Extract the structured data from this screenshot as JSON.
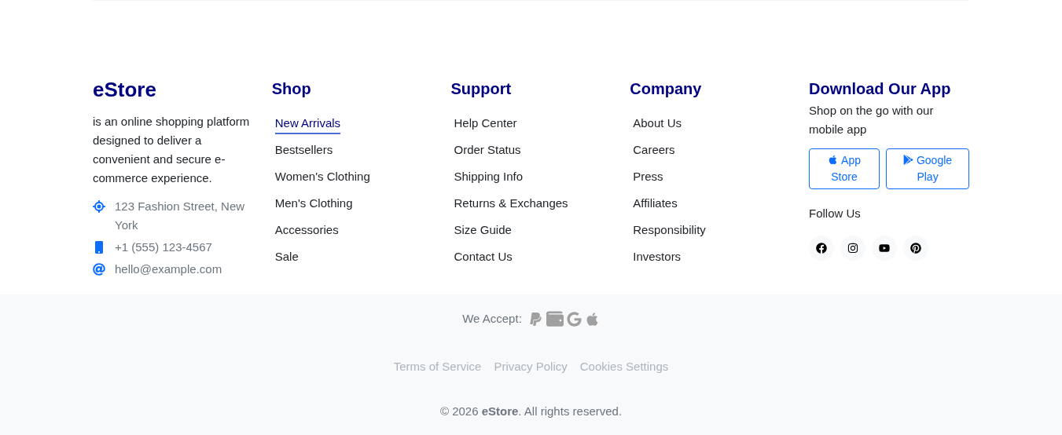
{
  "brand": {
    "name": "eStore",
    "description": "is an online shopping platform designed to deliver a convenient and secure e-commerce experience.",
    "contacts": [
      {
        "kind": "location",
        "text": "123 Fashion Street, New York"
      },
      {
        "kind": "phone",
        "text": "+1 (555) 123-4567"
      },
      {
        "kind": "email",
        "text": "hello@example.com"
      }
    ]
  },
  "columns": [
    {
      "title": "Shop",
      "links": [
        {
          "label": "New Arrivals",
          "selected": true
        },
        {
          "label": "Bestsellers",
          "selected": false
        },
        {
          "label": "Women's Clothing",
          "selected": false
        },
        {
          "label": "Men's Clothing",
          "selected": false
        },
        {
          "label": "Accessories",
          "selected": false
        },
        {
          "label": "Sale",
          "selected": false
        }
      ]
    },
    {
      "title": "Support",
      "links": [
        {
          "label": "Help Center",
          "selected": false
        },
        {
          "label": "Order Status",
          "selected": false
        },
        {
          "label": "Shipping Info",
          "selected": false
        },
        {
          "label": "Returns & Exchanges",
          "selected": false
        },
        {
          "label": "Size Guide",
          "selected": false
        },
        {
          "label": "Contact Us",
          "selected": false
        }
      ]
    },
    {
      "title": "Company",
      "links": [
        {
          "label": "About Us",
          "selected": false
        },
        {
          "label": "Careers",
          "selected": false
        },
        {
          "label": "Press",
          "selected": false
        },
        {
          "label": "Affiliates",
          "selected": false
        },
        {
          "label": "Responsibility",
          "selected": false
        },
        {
          "label": "Investors",
          "selected": false
        }
      ]
    }
  ],
  "app": {
    "title": "Download Our App",
    "text": "Shop on the go with our mobile app",
    "buttons": [
      {
        "kind": "apple",
        "label": "App Store"
      },
      {
        "kind": "google",
        "label": "Google Play"
      }
    ],
    "follow_title": "Follow Us",
    "social": [
      {
        "kind": "facebook"
      },
      {
        "kind": "instagram"
      },
      {
        "kind": "youtube"
      },
      {
        "kind": "pinterest"
      }
    ]
  },
  "payments": {
    "label": "We Accept:",
    "methods": [
      {
        "kind": "paypal"
      },
      {
        "kind": "wallet"
      },
      {
        "kind": "google"
      },
      {
        "kind": "apple"
      }
    ]
  },
  "legal_links": [
    "Terms of Service",
    "Privacy Policy",
    "Cookies Settings"
  ],
  "copyright": "© 2026 **eStore**. All rights reserved."
}
